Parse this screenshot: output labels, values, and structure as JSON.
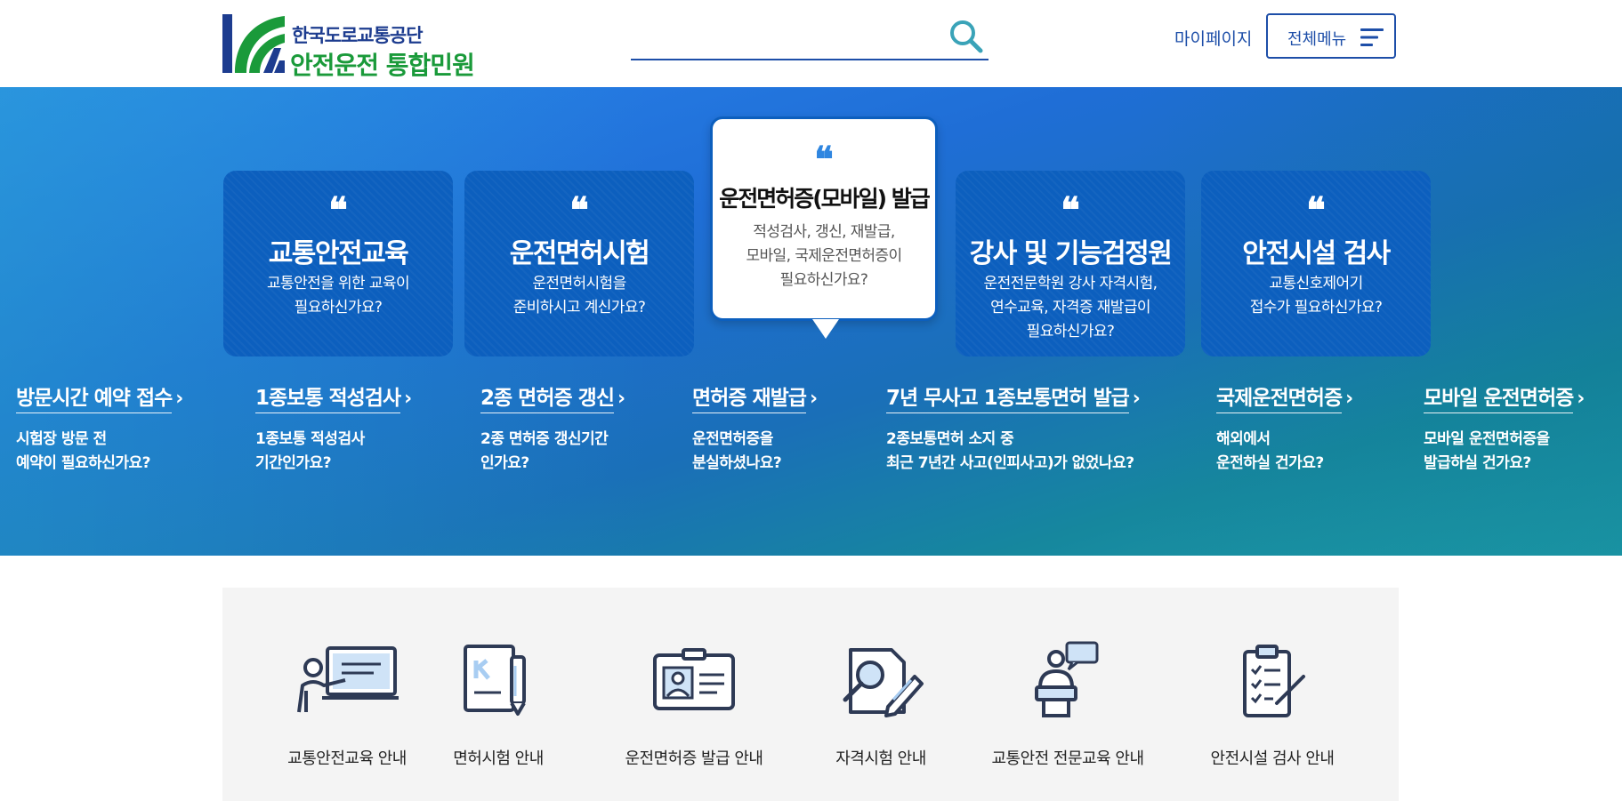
{
  "header": {
    "org_name": "한국도로교통공단",
    "site_title": "안전운전 통합민원",
    "search": {
      "value": "",
      "placeholder": ""
    },
    "mypage_label": "마이페이지",
    "menu_label": "전체메뉴"
  },
  "hero": {
    "cards": [
      {
        "title": "교통안전교육",
        "desc": [
          "교통안전을 위한 교육이",
          "필요하신가요?"
        ]
      },
      {
        "title": "운전면허시험",
        "desc": [
          "운전면허시험을",
          "준비하시고 계신가요?"
        ]
      },
      {
        "title": "운전면허증(모바일) 발급",
        "desc": [
          "적성검사, 갱신, 재발급,",
          "모바일, 국제운전면허증이",
          "필요하신가요?"
        ],
        "active": true
      },
      {
        "title": "강사 및 기능검정원",
        "desc": [
          "운전전문학원 강사 자격시험,",
          "연수교육, 자격증 재발급이",
          "필요하신가요?"
        ]
      },
      {
        "title": "안전시설 검사",
        "desc": [
          "교통신호제어기",
          "접수가 필요하신가요?"
        ]
      }
    ],
    "quick_links": [
      {
        "title": "방문시간 예약 접수",
        "desc": [
          "시험장 방문 전",
          "예약이 필요하신가요?"
        ]
      },
      {
        "title": "1종보통 적성검사",
        "desc": [
          "1종보통 적성검사",
          "기간인가요?"
        ]
      },
      {
        "title": "2종 면허증 갱신",
        "desc": [
          "2종 면허증 갱신기간",
          "인가요?"
        ]
      },
      {
        "title": "면허증 재발급",
        "desc": [
          "운전면허증을",
          "분실하셨나요?"
        ]
      },
      {
        "title": "7년 무사고 1종보통면허 발급",
        "desc": [
          "2종보통면허 소지 중",
          "최근 7년간 사고(인피사고)가 없었나요?"
        ]
      },
      {
        "title": "국제운전면허증",
        "desc": [
          "해외에서",
          "운전하실 건가요?"
        ]
      },
      {
        "title": "모바일 운전면허증",
        "desc": [
          "모바일 운전면허증을",
          "발급하실 건가요?"
        ]
      }
    ],
    "arrow_glyph": "›",
    "quote_glyph": "❝"
  },
  "guide": {
    "items": [
      {
        "label": "교통안전교육 안내",
        "icon": "presentation-icon"
      },
      {
        "label": "면허시험 안내",
        "icon": "document-pen-icon"
      },
      {
        "label": "운전면허증 발급 안내",
        "icon": "id-card-icon"
      },
      {
        "label": "자격시험 안내",
        "icon": "exam-search-icon"
      },
      {
        "label": "교통안전 전문교육 안내",
        "icon": "lecturer-icon"
      },
      {
        "label": "안전시설 검사 안내",
        "icon": "clipboard-checklist-icon"
      }
    ]
  },
  "colors": {
    "brand_blue": "#1d4ea8",
    "brand_green": "#1a9a3a",
    "card_blue": "#0c5fbe",
    "accent_quote": "#2f86e0",
    "guide_bg": "#f4f4f4"
  }
}
